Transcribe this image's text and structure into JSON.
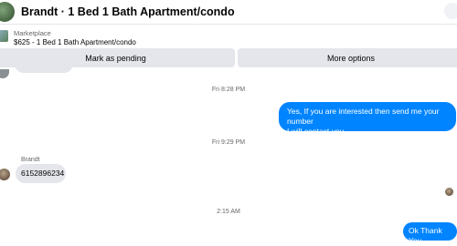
{
  "header": {
    "title": "Brandt · 1 Bed 1 Bath Apartment/condo"
  },
  "listing": {
    "source": "Marketplace",
    "title": "$625 - 1 Bed 1 Bath Apartment/condo"
  },
  "actions": {
    "mark_pending": "Mark as pending",
    "more_options": "More options"
  },
  "messages": {
    "time_1": "Fri 8:28 PM",
    "outgoing_1_line1": "Yes, If you are interested then send me your number",
    "outgoing_1_line2": "I will contact you.",
    "time_2": "Fri 9:29 PM",
    "sender_name": "Brandt",
    "incoming_1": "6152896234",
    "time_3": "2:15 AM",
    "outgoing_2": "Ok Thank You"
  },
  "colors": {
    "accent": "#0084ff",
    "bubble_incoming": "#e4e6eb",
    "secondary_text": "#65676b"
  },
  "icons": {
    "contact_avatar": "avatar",
    "listing_thumbnail": "listing-thumbnail",
    "read_receipt": "read-receipt-avatar"
  }
}
